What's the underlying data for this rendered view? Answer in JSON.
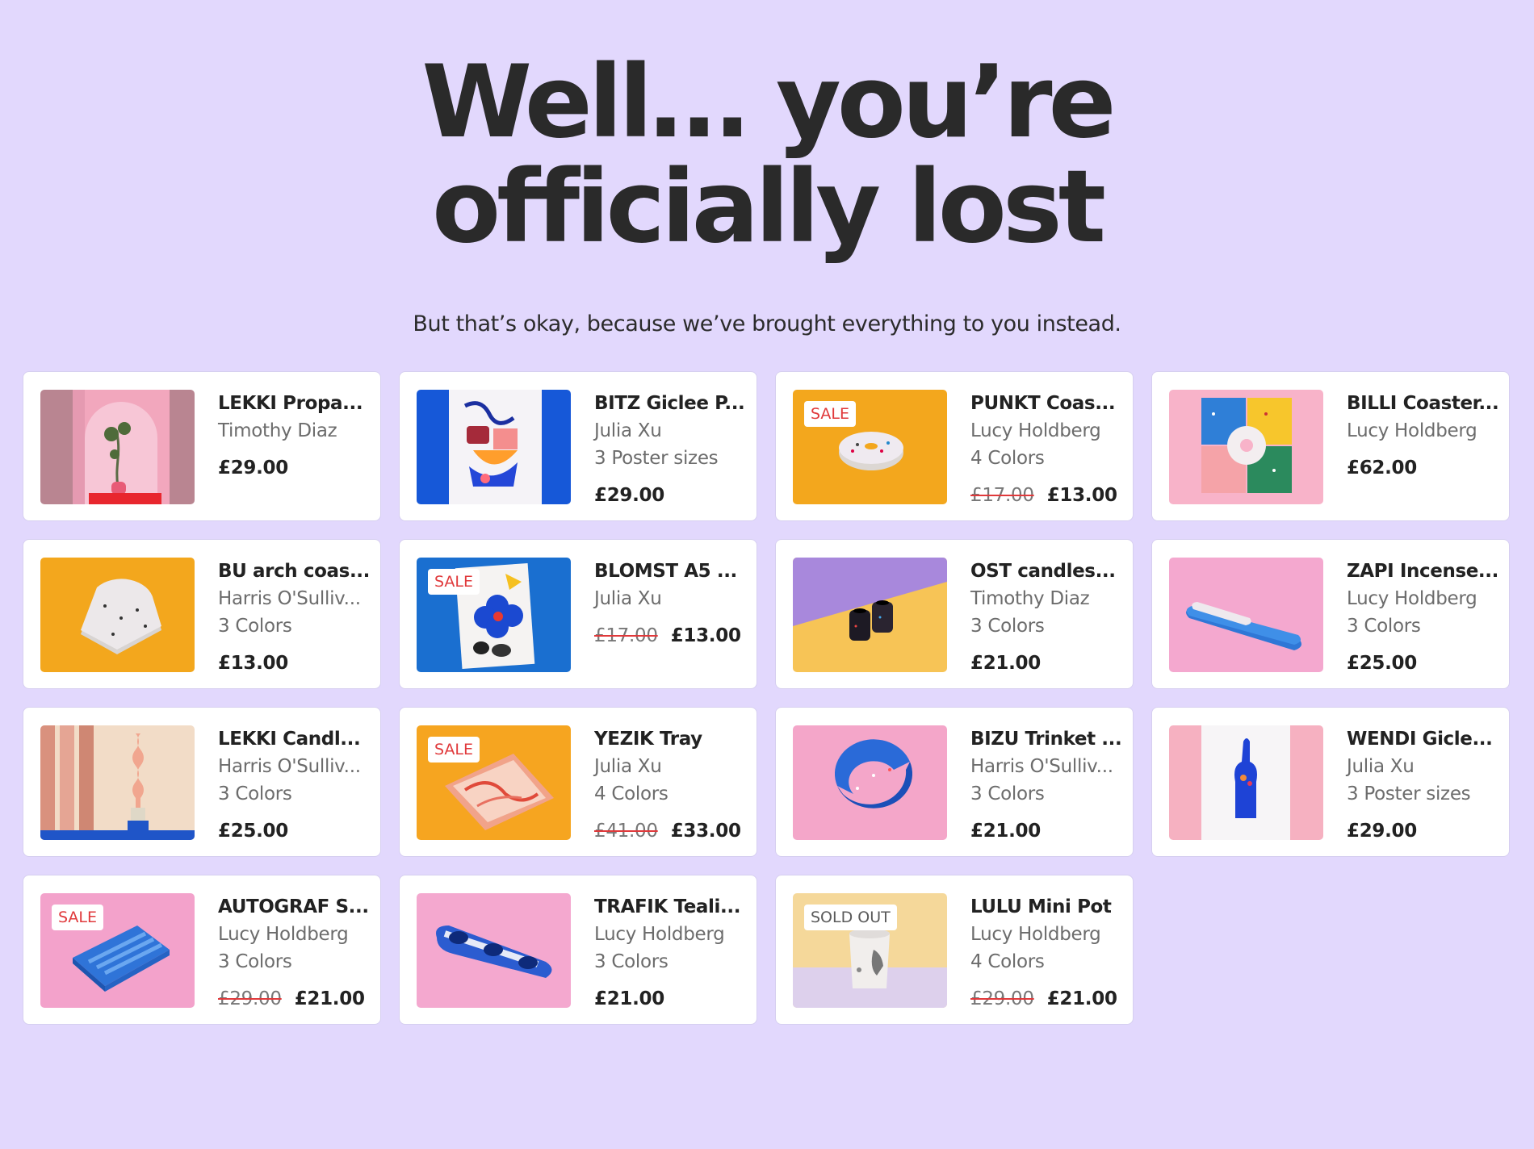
{
  "hero": {
    "title_line1": "Well… you’re",
    "title_line2": "officially lost",
    "subtitle": "But that’s okay, because we’ve brought everything to you instead."
  },
  "products": [
    {
      "title": "LEKKI Propa...",
      "artist": "Timothy Diaz",
      "variant": "",
      "old_price": "",
      "price": "£29.00",
      "badge": "",
      "image": "pink-arch-plant"
    },
    {
      "title": "BITZ Giclee P...",
      "artist": "Julia Xu",
      "variant": "3 Poster sizes",
      "old_price": "",
      "price": "£29.00",
      "badge": "",
      "image": "blue-poster-art"
    },
    {
      "title": "PUNKT Coas...",
      "artist": "Lucy Holdberg",
      "variant": "4 Colors",
      "old_price": "£17.00",
      "price": "£13.00",
      "badge": "SALE",
      "image": "yellow-round-coaster"
    },
    {
      "title": "BILLI Coaster...",
      "artist": "Lucy Holdberg",
      "variant": "",
      "old_price": "",
      "price": "£62.00",
      "badge": "",
      "image": "four-tile-coasters"
    },
    {
      "title": "BU arch coas...",
      "artist": "Harris O'Sulliv...",
      "variant": "3 Colors",
      "old_price": "",
      "price": "£13.00",
      "badge": "",
      "image": "arch-terrazzo-coaster"
    },
    {
      "title": "BLOMST A5 ...",
      "artist": "Julia Xu",
      "variant": "",
      "old_price": "£17.00",
      "price": "£13.00",
      "badge": "SALE",
      "image": "flower-print"
    },
    {
      "title": "OST candles...",
      "artist": "Timothy Diaz",
      "variant": "3 Colors",
      "old_price": "",
      "price": "£21.00",
      "badge": "",
      "image": "black-candle-holders"
    },
    {
      "title": "ZAPI Incense...",
      "artist": "Lucy Holdberg",
      "variant": "3 Colors",
      "old_price": "",
      "price": "£25.00",
      "badge": "",
      "image": "blue-incense-holder"
    },
    {
      "title": "LEKKI Candl...",
      "artist": "Harris O'Sulliv...",
      "variant": "3 Colors",
      "old_price": "",
      "price": "£25.00",
      "badge": "",
      "image": "twisted-candle"
    },
    {
      "title": "YEZIK Tray",
      "artist": "Julia Xu",
      "variant": "4 Colors",
      "old_price": "£41.00",
      "price": "£33.00",
      "badge": "SALE",
      "image": "marble-tray"
    },
    {
      "title": "BIZU Trinket ...",
      "artist": "Harris O'Sulliv...",
      "variant": "3 Colors",
      "old_price": "",
      "price": "£21.00",
      "badge": "",
      "image": "half-moon-dish"
    },
    {
      "title": "WENDI Gicle...",
      "artist": "Julia Xu",
      "variant": "3 Poster sizes",
      "old_price": "",
      "price": "£29.00",
      "badge": "",
      "image": "hand-poster"
    },
    {
      "title": "AUTOGRAF S...",
      "artist": "Lucy Holdberg",
      "variant": "3 Colors",
      "old_price": "£29.00",
      "price": "£21.00",
      "badge": "SALE",
      "image": "ribbed-soap-dish"
    },
    {
      "title": "TRAFIK Teali...",
      "artist": "Lucy Holdberg",
      "variant": "3 Colors",
      "old_price": "",
      "price": "£21.00",
      "badge": "",
      "image": "marble-tealight-holder"
    },
    {
      "title": "LULU Mini Pot",
      "artist": "Lucy Holdberg",
      "variant": "4 Colors",
      "old_price": "£29.00",
      "price": "£21.00",
      "badge": "SOLD OUT",
      "image": "mini-pot"
    }
  ],
  "colors": {
    "background": "#e2d8fd",
    "sale": "#e0393b",
    "card": "#ffffff"
  }
}
